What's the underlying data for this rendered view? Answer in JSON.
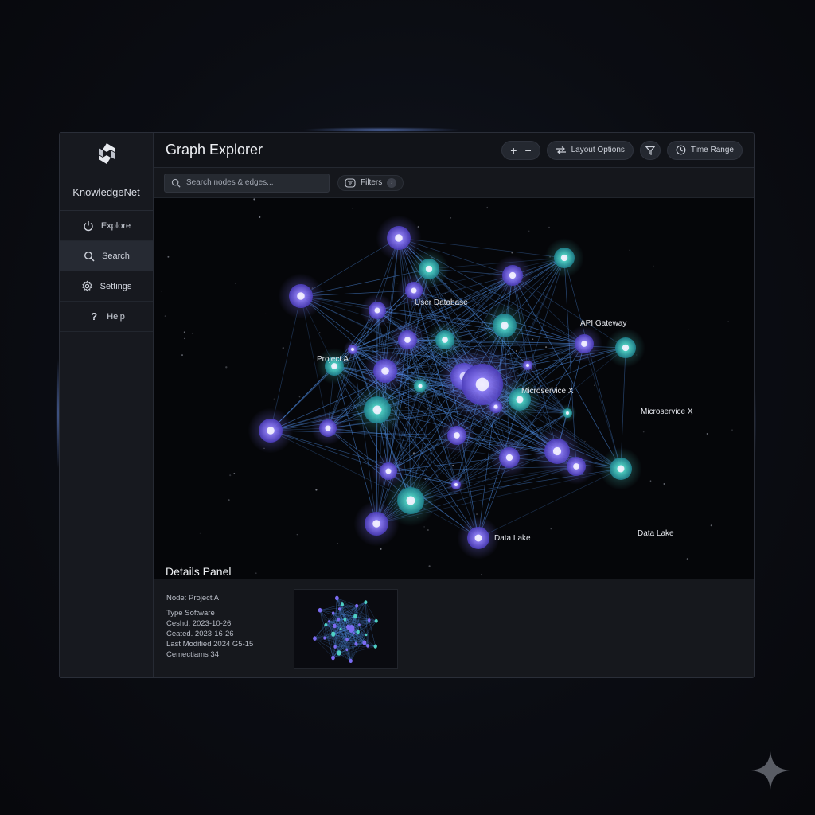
{
  "sidebar": {
    "brand": "KnowledgeNet",
    "items": [
      {
        "label": "Explore",
        "icon": "power-icon"
      },
      {
        "label": "Search",
        "icon": "search-icon",
        "active": true
      },
      {
        "label": "Settings",
        "icon": "gear-icon"
      },
      {
        "label": "Help",
        "icon": "help-icon"
      }
    ]
  },
  "header": {
    "title": "Graph Explorer",
    "zoom_in": "+",
    "zoom_out": "−",
    "layout_options": "Layout Options",
    "time_range": "Time Range"
  },
  "search": {
    "placeholder": "Search nodes & edges...",
    "filters_label": "Filters"
  },
  "graph": {
    "labels": {
      "user_database": "User Database",
      "api_gateway": "API Gateway",
      "project_a": "Project A",
      "microservice_inner": "Microservice X",
      "microservice_outer": "Microservice X",
      "data_lake_right": "Data Lake",
      "data_lake_bottom": "Data Lake"
    },
    "colors": {
      "purple_node": "#7b6cf2",
      "teal_node": "#4fd1c5",
      "edge": "#4a86d9"
    }
  },
  "details": {
    "title": "Details Panel",
    "node": "Node: Project A",
    "type": "Type Software",
    "created_1": "Ceshd. 2023-10-26",
    "created_2": "Ceated. 2023-16-26",
    "last_modified": "Last Modified 2024 G5-15",
    "connections": "Cemectiams 34"
  }
}
